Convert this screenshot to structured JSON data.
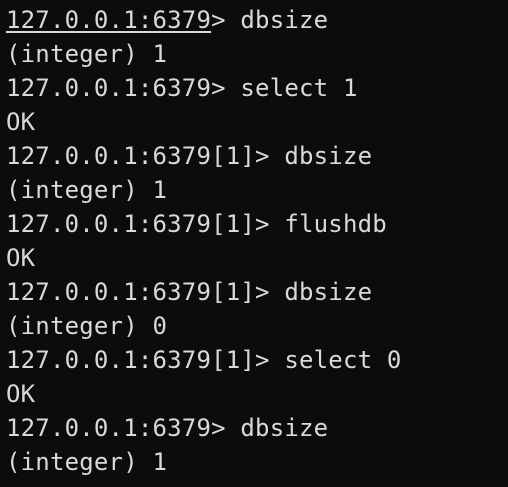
{
  "terminal": {
    "lines": [
      {
        "prompt": "127.0.0.1:6379",
        "suffix": "> ",
        "command": "dbsize"
      },
      {
        "output": "(integer) 1"
      },
      {
        "prompt": "127.0.0.1:6379",
        "suffix": "> ",
        "command": "select 1"
      },
      {
        "output": "OK"
      },
      {
        "prompt": "127.0.0.1:6379",
        "suffix": "[1]> ",
        "command": "dbsize"
      },
      {
        "output": "(integer) 1"
      },
      {
        "prompt": "127.0.0.1:6379",
        "suffix": "[1]> ",
        "command": "flushdb"
      },
      {
        "output": "OK"
      },
      {
        "prompt": "127.0.0.1:6379",
        "suffix": "[1]> ",
        "command": "dbsize"
      },
      {
        "output": "(integer) 0"
      },
      {
        "prompt": "127.0.0.1:6379",
        "suffix": "[1]> ",
        "command": "select 0"
      },
      {
        "output": "OK"
      },
      {
        "prompt": "127.0.0.1:6379",
        "suffix": "> ",
        "command": "dbsize"
      },
      {
        "output": "(integer) 1"
      }
    ]
  }
}
